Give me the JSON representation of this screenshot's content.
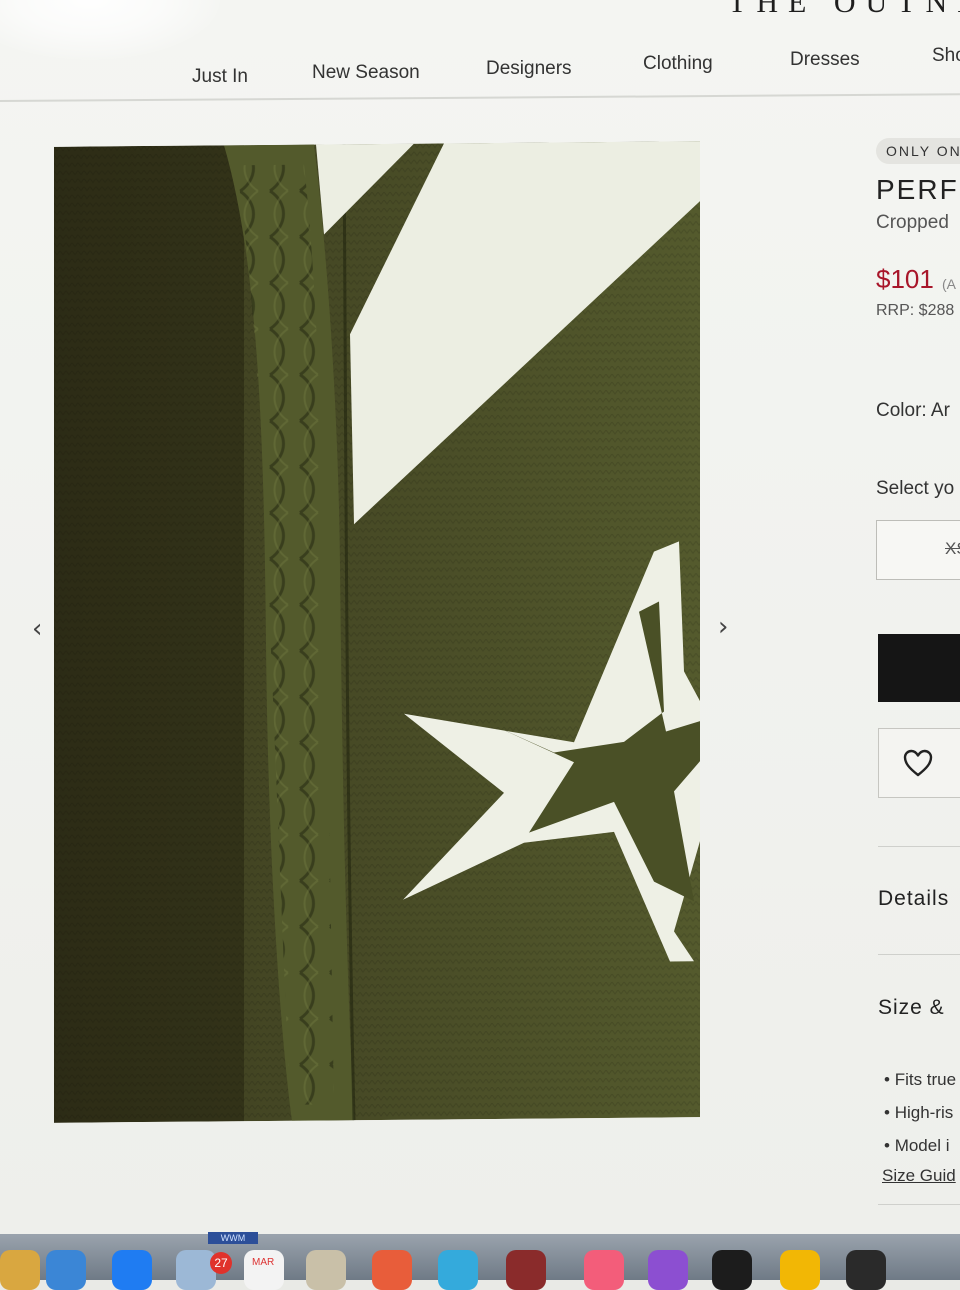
{
  "site": {
    "logo": "THE OUTNET"
  },
  "nav": {
    "items": [
      "Just In",
      "New Season",
      "Designers",
      "Clothing",
      "Dresses",
      "Sho"
    ]
  },
  "product": {
    "badge": "ONLY ON",
    "title": "PERFE",
    "subtitle": "Cropped",
    "price": "$101",
    "price_note": "(A",
    "rrp": "RRP: $288",
    "color_label": "Color: Ar",
    "select_label": "Select yo",
    "size_option": "XS",
    "details_heading": "Details",
    "size_fit_heading": "Size &",
    "fit_bullets": [
      "Fits true",
      "High-ris",
      "Model i"
    ],
    "size_guide": "Size Guid"
  },
  "gallery": {
    "prev_icon": "chevron-left-icon",
    "next_icon": "chevron-right-icon"
  },
  "dock": {
    "badge_count": "27",
    "calendar_month": "MAR",
    "top_label": "WWM"
  },
  "colors": {
    "price": "#a8162a",
    "garment": "#4f5428",
    "stripe": "#eef0e6"
  }
}
